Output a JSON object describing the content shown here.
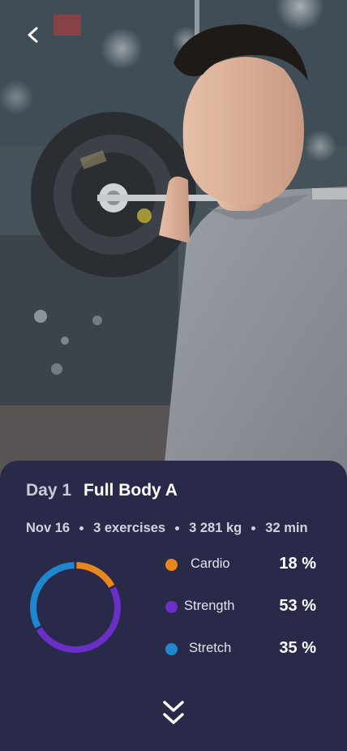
{
  "header": {
    "back_icon": "chevron-left-icon"
  },
  "workout": {
    "day_label": "Day 1",
    "name": "Full Body A",
    "date": "Nov 16",
    "exercises": "3 exercises",
    "volume": "3 281 kg",
    "duration": "32 min"
  },
  "breakdown": [
    {
      "label": "Cardio",
      "value": "18 %",
      "percent": 18,
      "color": "#e8871e"
    },
    {
      "label": "Strength",
      "value": "53 %",
      "percent": 53,
      "color": "#6a2fc7"
    },
    {
      "label": "Stretch",
      "value": "35 %",
      "percent": 35,
      "color": "#1f86d0"
    }
  ],
  "footer": {
    "expand_icon": "double-chevron-down-icon"
  }
}
